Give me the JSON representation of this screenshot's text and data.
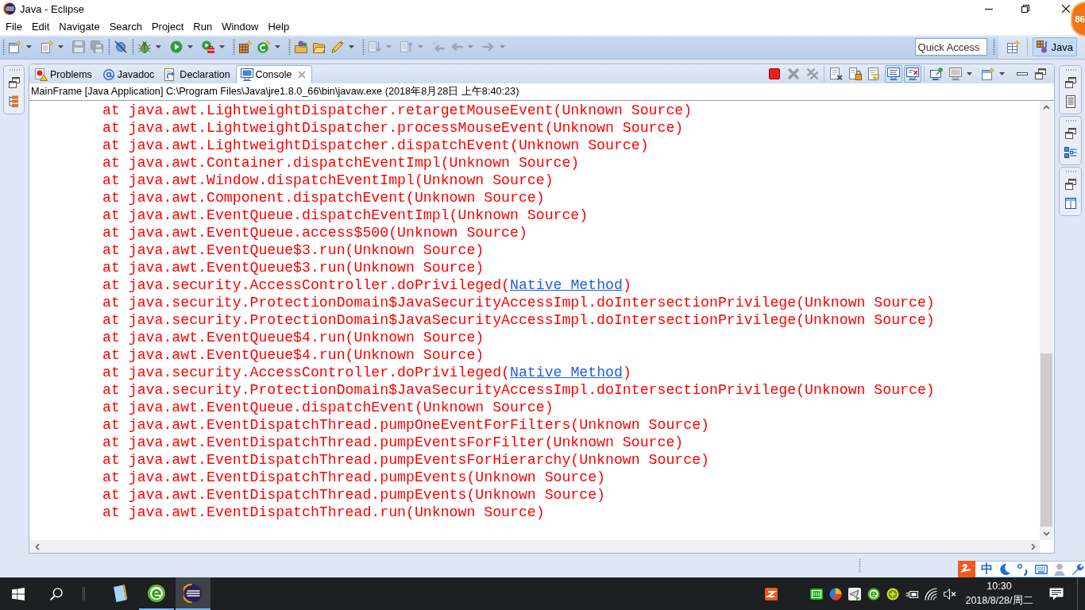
{
  "window": {
    "title": "Java - Eclipse",
    "badge": "86"
  },
  "menu": [
    "File",
    "Edit",
    "Navigate",
    "Search",
    "Project",
    "Run",
    "Window",
    "Help"
  ],
  "toolbar": {
    "groups": [
      [
        {
          "kind": "new",
          "disabled": false,
          "dropdown": true
        },
        {
          "kind": "new-file",
          "disabled": false,
          "dropdown": true
        },
        {
          "kind": "save",
          "disabled": true,
          "dropdown": false
        },
        {
          "kind": "save-all",
          "disabled": true,
          "dropdown": false
        }
      ],
      [
        {
          "kind": "skip-breakpoints",
          "disabled": false,
          "dropdown": false
        }
      ],
      [
        {
          "kind": "debug",
          "disabled": false,
          "dropdown": true
        },
        {
          "kind": "run",
          "disabled": false,
          "dropdown": true
        },
        {
          "kind": "external-tools",
          "disabled": false,
          "dropdown": true
        }
      ],
      [
        {
          "kind": "new-package",
          "disabled": false,
          "dropdown": false
        },
        {
          "kind": "new-class",
          "disabled": false,
          "dropdown": true
        }
      ],
      [
        {
          "kind": "open-type",
          "disabled": false,
          "dropdown": false
        },
        {
          "kind": "open-task",
          "disabled": false,
          "dropdown": false
        },
        {
          "kind": "search",
          "disabled": false,
          "dropdown": true
        }
      ],
      [
        {
          "kind": "next-annotation",
          "disabled": true,
          "dropdown": true
        },
        {
          "kind": "previous-annotation",
          "disabled": true,
          "dropdown": true
        },
        {
          "kind": "last-edit",
          "disabled": true,
          "dropdown": false
        },
        {
          "kind": "back",
          "disabled": true,
          "dropdown": true
        },
        {
          "kind": "forward",
          "disabled": true,
          "dropdown": true
        }
      ]
    ]
  },
  "quick_access": {
    "placeholder": "Quick Access"
  },
  "perspectives": [
    {
      "label": "Java",
      "selected": true
    }
  ],
  "console_view": {
    "tabs": [
      {
        "label": "Problems",
        "kind": "problems",
        "selected": false
      },
      {
        "label": "Javadoc",
        "kind": "javadoc",
        "selected": false
      },
      {
        "label": "Declaration",
        "kind": "declaration",
        "selected": false
      },
      {
        "label": "Console",
        "kind": "console",
        "selected": true
      }
    ],
    "toolbar": [
      [
        {
          "kind": "terminate",
          "disabled": false,
          "pressed": false,
          "dropdown": false
        },
        {
          "kind": "remove-launch",
          "disabled": true,
          "pressed": false,
          "dropdown": false
        },
        {
          "kind": "remove-all",
          "disabled": true,
          "pressed": false,
          "dropdown": false
        }
      ],
      [
        {
          "kind": "clear",
          "disabled": false,
          "pressed": false,
          "dropdown": false
        },
        {
          "kind": "scroll-lock",
          "disabled": false,
          "pressed": false,
          "dropdown": false
        },
        {
          "kind": "word-wrap",
          "disabled": false,
          "pressed": false,
          "dropdown": false
        },
        {
          "kind": "show-stdout",
          "disabled": false,
          "pressed": true,
          "dropdown": false
        },
        {
          "kind": "show-stderr",
          "disabled": false,
          "pressed": true,
          "dropdown": false
        }
      ],
      [
        {
          "kind": "pin",
          "disabled": false,
          "pressed": false,
          "dropdown": false
        },
        {
          "kind": "display-console",
          "disabled": false,
          "pressed": false,
          "dropdown": true
        },
        {
          "kind": "open-console",
          "disabled": false,
          "pressed": false,
          "dropdown": true
        }
      ]
    ],
    "description": "MainFrame [Java Application] C:\\Program Files\\Java\\jre1.8.0_66\\bin\\javaw.exe (2018年8月28日 上午8:40:23)",
    "lines": [
      {
        "text": "at java.awt.LightweightDispatcher.retargetMouseEvent(Unknown Source)"
      },
      {
        "text": "at java.awt.LightweightDispatcher.processMouseEvent(Unknown Source)"
      },
      {
        "text": "at java.awt.LightweightDispatcher.dispatchEvent(Unknown Source)"
      },
      {
        "text": "at java.awt.Container.dispatchEventImpl(Unknown Source)"
      },
      {
        "text": "at java.awt.Window.dispatchEventImpl(Unknown Source)"
      },
      {
        "text": "at java.awt.Component.dispatchEvent(Unknown Source)"
      },
      {
        "text": "at java.awt.EventQueue.dispatchEventImpl(Unknown Source)"
      },
      {
        "text": "at java.awt.EventQueue.access$500(Unknown Source)"
      },
      {
        "text": "at java.awt.EventQueue$3.run(Unknown Source)"
      },
      {
        "text": "at java.awt.EventQueue$3.run(Unknown Source)"
      },
      {
        "text": "at java.security.AccessController.doPrivileged(",
        "link": "Native Method",
        "after": ")"
      },
      {
        "text": "at java.security.ProtectionDomain$JavaSecurityAccessImpl.doIntersectionPrivilege(Unknown Source)"
      },
      {
        "text": "at java.security.ProtectionDomain$JavaSecurityAccessImpl.doIntersectionPrivilege(Unknown Source)"
      },
      {
        "text": "at java.awt.EventQueue$4.run(Unknown Source)"
      },
      {
        "text": "at java.awt.EventQueue$4.run(Unknown Source)"
      },
      {
        "text": "at java.security.AccessController.doPrivileged(",
        "link": "Native Method",
        "after": ")"
      },
      {
        "text": "at java.security.ProtectionDomain$JavaSecurityAccessImpl.doIntersectionPrivilege(Unknown Source)"
      },
      {
        "text": "at java.awt.EventQueue.dispatchEvent(Unknown Source)"
      },
      {
        "text": "at java.awt.EventDispatchThread.pumpOneEventForFilters(Unknown Source)"
      },
      {
        "text": "at java.awt.EventDispatchThread.pumpEventsForFilter(Unknown Source)"
      },
      {
        "text": "at java.awt.EventDispatchThread.pumpEventsForHierarchy(Unknown Source)"
      },
      {
        "text": "at java.awt.EventDispatchThread.pumpEvents(Unknown Source)"
      },
      {
        "text": "at java.awt.EventDispatchThread.pumpEvents(Unknown Source)"
      },
      {
        "text": "at java.awt.EventDispatchThread.run(Unknown Source)"
      }
    ]
  },
  "ime_bar": {
    "mode": "中"
  },
  "taskbar": {
    "apps": [
      {
        "kind": "notepad",
        "running": false,
        "selected": false
      },
      {
        "kind": "browser",
        "running": true,
        "selected": false
      },
      {
        "kind": "eclipse",
        "running": true,
        "selected": true
      }
    ],
    "tray": [
      {
        "kind": "tile-app"
      },
      {
        "kind": "video-app"
      },
      {
        "kind": "color-ball"
      },
      {
        "kind": "paper-plane"
      },
      {
        "kind": "browser"
      },
      {
        "kind": "plus"
      },
      {
        "kind": "battery"
      },
      {
        "kind": "wifi"
      },
      {
        "kind": "speaker-muted"
      }
    ],
    "time": "10:30",
    "date": "2018/8/28/周二"
  }
}
